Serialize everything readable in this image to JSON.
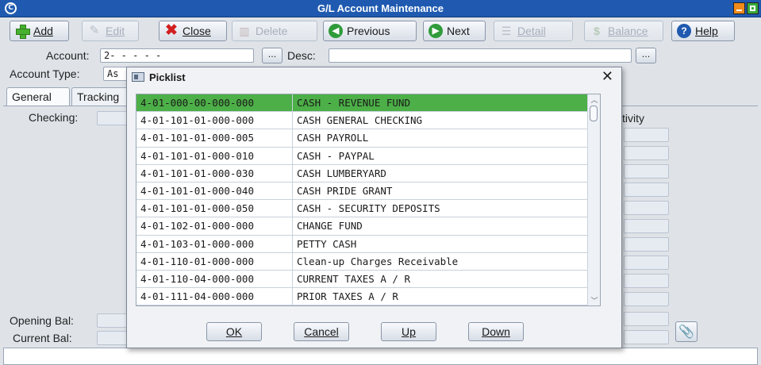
{
  "window": {
    "title": "G/L Account Maintenance"
  },
  "toolbar": {
    "add": "Add",
    "edit": "Edit",
    "close": "Close",
    "delete": "Delete",
    "previous": "Previous",
    "next": "Next",
    "detail": "Detail",
    "balance": "Balance",
    "help": "Help"
  },
  "form": {
    "account_label": "Account:",
    "account_value": "2-  -  -  -  -",
    "ellipsis": "...",
    "desc_label": "Desc:",
    "desc_value": "",
    "account_type_label": "Account Type:",
    "account_type_value": "As",
    "checking_label": "Checking:",
    "activity_header": "tivity",
    "opening_bal_label": "Opening Bal:",
    "current_bal_label": "Current Bal:"
  },
  "tabs": [
    {
      "label": "General"
    },
    {
      "label": "Tracking"
    }
  ],
  "picklist": {
    "title": "Picklist",
    "rows": [
      {
        "account": "4-01-000-00-000-000",
        "description": "CASH - REVENUE FUND"
      },
      {
        "account": "4-01-101-01-000-000",
        "description": "CASH GENERAL CHECKING"
      },
      {
        "account": "4-01-101-01-000-005",
        "description": "CASH PAYROLL"
      },
      {
        "account": "4-01-101-01-000-010",
        "description": "CASH - PAYPAL"
      },
      {
        "account": "4-01-101-01-000-030",
        "description": "CASH LUMBERYARD"
      },
      {
        "account": "4-01-101-01-000-040",
        "description": "CASH PRIDE GRANT"
      },
      {
        "account": "4-01-101-01-000-050",
        "description": "CASH - SECURITY DEPOSITS"
      },
      {
        "account": "4-01-102-01-000-000",
        "description": "CHANGE FUND"
      },
      {
        "account": "4-01-103-01-000-000",
        "description": "PETTY CASH"
      },
      {
        "account": "4-01-110-01-000-000",
        "description": "Clean-up Charges Receivable"
      },
      {
        "account": "4-01-110-04-000-000",
        "description": "CURRENT TAXES A / R"
      },
      {
        "account": "4-01-111-04-000-000",
        "description": "PRIOR TAXES A / R"
      }
    ],
    "selected_index": 0,
    "buttons": {
      "ok": "OK",
      "cancel": "Cancel",
      "up": "Up",
      "down": "Down"
    }
  },
  "colors": {
    "titlebar": "#1f5ab0",
    "selection": "#4caf47",
    "background": "#dfe3e8"
  }
}
